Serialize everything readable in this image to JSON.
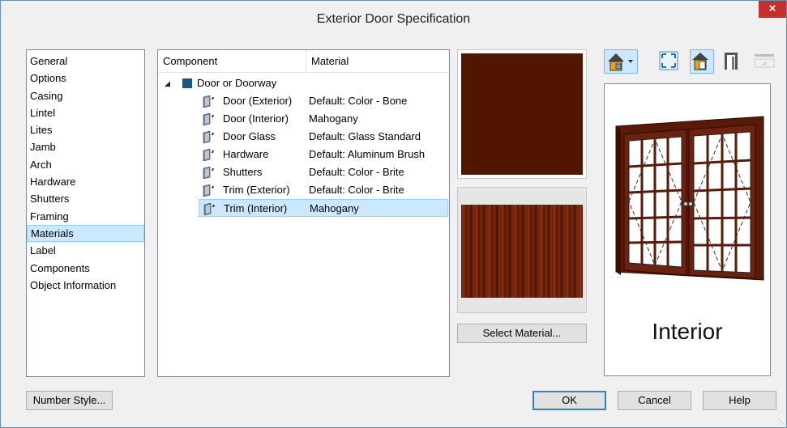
{
  "window": {
    "title": "Exterior Door Specification",
    "close_label": "×"
  },
  "nav": {
    "items": [
      {
        "label": "General",
        "selected": false
      },
      {
        "label": "Options",
        "selected": false
      },
      {
        "label": "Casing",
        "selected": false
      },
      {
        "label": "Lintel",
        "selected": false
      },
      {
        "label": "Lites",
        "selected": false
      },
      {
        "label": "Jamb",
        "selected": false
      },
      {
        "label": "Arch",
        "selected": false
      },
      {
        "label": "Hardware",
        "selected": false
      },
      {
        "label": "Shutters",
        "selected": false
      },
      {
        "label": "Framing",
        "selected": false
      },
      {
        "label": "Materials",
        "selected": true
      },
      {
        "label": "Label",
        "selected": false
      },
      {
        "label": "Components",
        "selected": false
      },
      {
        "label": "Object Information",
        "selected": false
      }
    ]
  },
  "tree": {
    "col_component": "Component",
    "col_material": "Material",
    "expander": "◢",
    "root": "Door or Doorway",
    "rows": [
      {
        "component": "Door (Exterior)",
        "material": "Default: Color - Bone",
        "selected": false
      },
      {
        "component": "Door (Interior)",
        "material": "Mahogany",
        "selected": false
      },
      {
        "component": "Door Glass",
        "material": "Default: Glass  Standard",
        "selected": false
      },
      {
        "component": "Hardware",
        "material": "Default: Aluminum Brush",
        "selected": false
      },
      {
        "component": "Shutters",
        "material": "Default: Color - Brite",
        "selected": false
      },
      {
        "component": "Trim (Exterior)",
        "material": "Default: Color - Brite",
        "selected": false
      },
      {
        "component": "Trim (Interior)",
        "material": "Mahogany",
        "selected": true
      }
    ]
  },
  "material_panel": {
    "select_label": "Select Material..."
  },
  "preview": {
    "label": "Interior",
    "toolbar_icons": [
      "view-mode-icon",
      "fit-view-icon",
      "door-view-icon",
      "door-frame-icon",
      "reset-icon"
    ]
  },
  "buttons": {
    "number_style": "Number Style...",
    "ok": "OK",
    "cancel": "Cancel",
    "help": "Help"
  },
  "colors": {
    "solid_swatch": "#521600",
    "selection": "#cce8ff",
    "close": "#c7302a"
  }
}
